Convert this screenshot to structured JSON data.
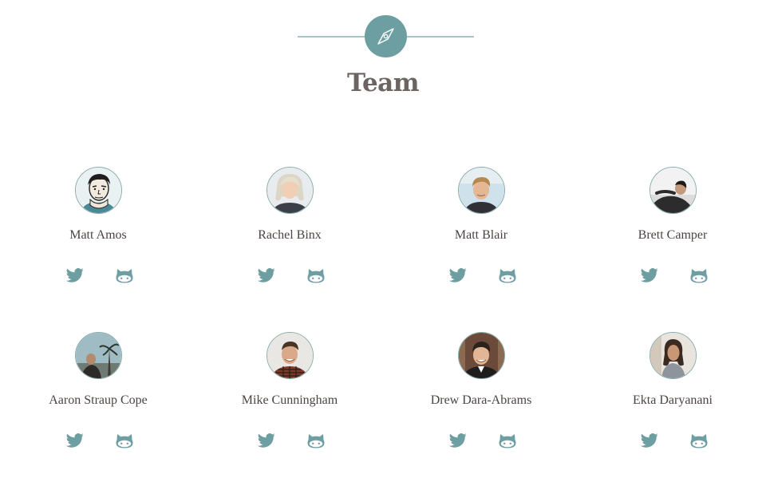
{
  "page": {
    "title": "Team",
    "accent_color": "#6d9ea2",
    "header_icon": "compass-icon"
  },
  "members": [
    {
      "name": "Matt Amos",
      "avatar": "cartoon-portrait",
      "links": [
        "twitter-icon",
        "github-icon"
      ]
    },
    {
      "name": "Rachel Binx",
      "avatar": "photo-portrait",
      "links": [
        "twitter-icon",
        "github-icon"
      ]
    },
    {
      "name": "Matt Blair",
      "avatar": "photo-portrait",
      "links": [
        "twitter-icon",
        "github-icon"
      ]
    },
    {
      "name": "Brett Camper",
      "avatar": "photo-portrait",
      "links": [
        "twitter-icon",
        "github-icon"
      ]
    },
    {
      "name": "Aaron Straup Cope",
      "avatar": "photo-portrait",
      "links": [
        "twitter-icon",
        "github-icon"
      ]
    },
    {
      "name": "Mike Cunningham",
      "avatar": "photo-portrait",
      "links": [
        "twitter-icon",
        "github-icon"
      ]
    },
    {
      "name": "Drew Dara-Abrams",
      "avatar": "photo-portrait",
      "links": [
        "twitter-icon",
        "github-icon"
      ]
    },
    {
      "name": "Ekta Daryanani",
      "avatar": "photo-portrait",
      "links": [
        "twitter-icon",
        "github-icon"
      ]
    }
  ]
}
